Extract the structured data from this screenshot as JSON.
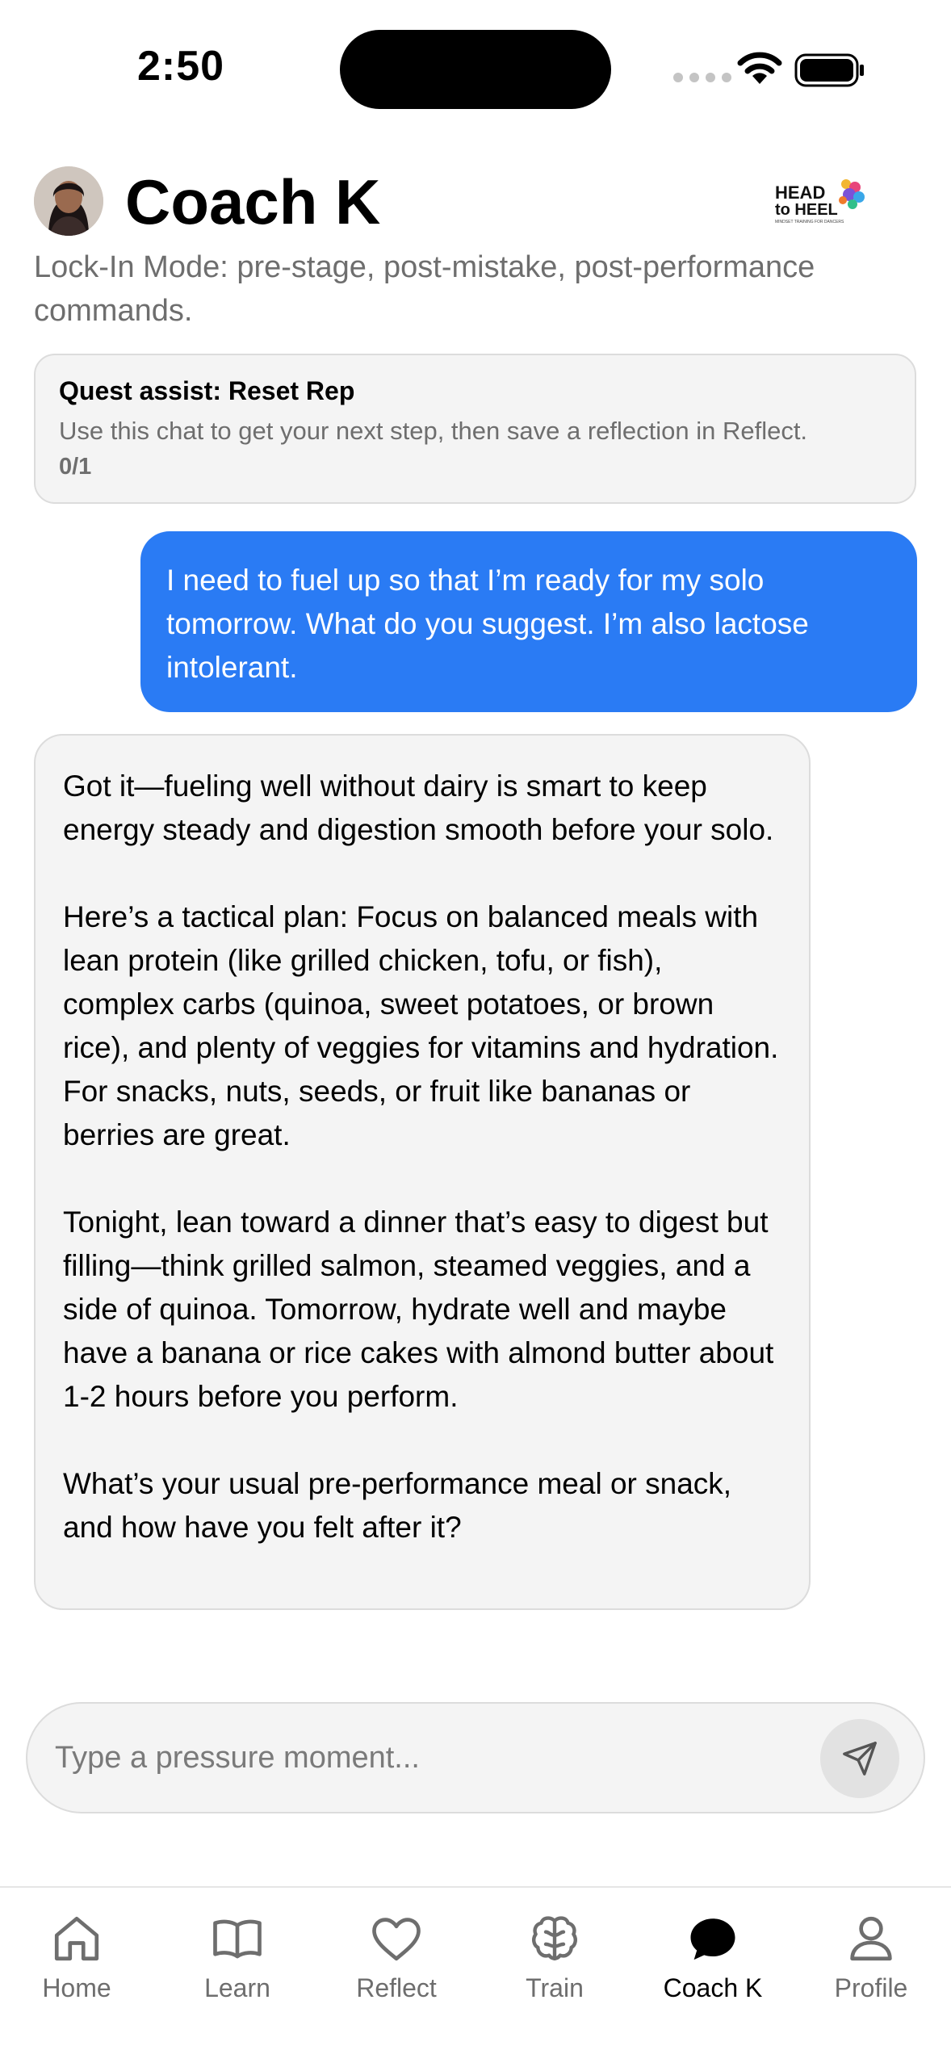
{
  "status_bar": {
    "time": "2:50"
  },
  "header": {
    "title": "Coach K",
    "subtitle": "Lock-In Mode: pre-stage, post-mistake, post-performance commands.",
    "logo": {
      "line1": "HEAD",
      "line2": "to HEEL",
      "tagline": "MINDSET TRAINING FOR DANCERS"
    }
  },
  "quest": {
    "title": "Quest assist: Reset Rep",
    "description": "Use this chat to get your next step, then save a reflection in Reflect.",
    "progress": "0/1"
  },
  "messages": [
    {
      "role": "user",
      "text": "I need to fuel up so that I’m ready for my solo tomorrow. What do you suggest. I’m also lactose intolerant."
    },
    {
      "role": "coach",
      "paragraphs": [
        "Got it—fueling well without dairy is smart to keep energy steady and digestion smooth before your solo.",
        "Here’s a tactical plan: Focus on balanced meals with lean protein (like grilled chicken, tofu, or fish), complex carbs (quinoa, sweet potatoes, or brown rice), and plenty of veggies for vitamins and hydration. For snacks, nuts, seeds, or fruit like bananas or berries are great.",
        "Tonight, lean toward a dinner that’s easy to digest but filling—think grilled salmon, steamed veggies, and a side of quinoa. Tomorrow, hydrate well and maybe have a banana or rice cakes with almond butter about 1-2 hours before you perform.",
        "What’s your usual pre-performance meal or snack, and how have you felt after it?"
      ]
    }
  ],
  "composer": {
    "placeholder": "Type a pressure moment...",
    "value": ""
  },
  "tabs": [
    {
      "label": "Home",
      "icon": "home-icon",
      "active": false
    },
    {
      "label": "Learn",
      "icon": "book-icon",
      "active": false
    },
    {
      "label": "Reflect",
      "icon": "heart-icon",
      "active": false
    },
    {
      "label": "Train",
      "icon": "brain-icon",
      "active": false
    },
    {
      "label": "Coach K",
      "icon": "chat-bubble-icon",
      "active": true
    },
    {
      "label": "Profile",
      "icon": "person-icon",
      "active": false
    }
  ],
  "colors": {
    "accent": "#2a7bf4",
    "bubble_bg": "#f4f4f4",
    "muted_text": "#6e6e6e"
  }
}
